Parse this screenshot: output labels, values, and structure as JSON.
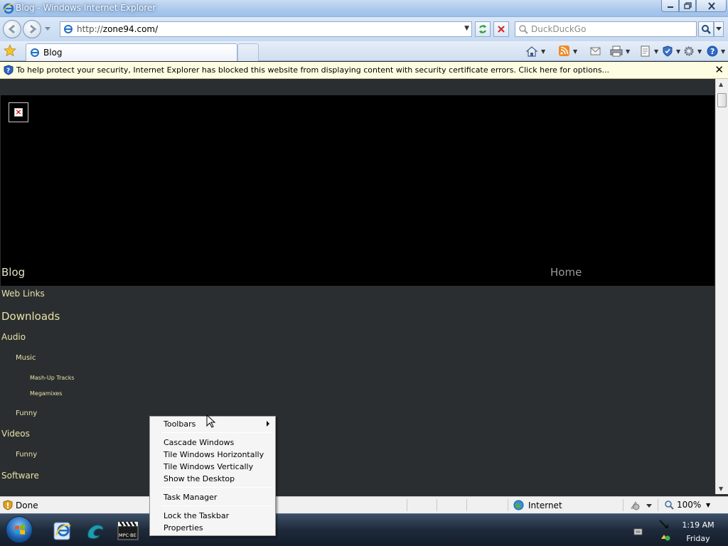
{
  "window": {
    "title": "Blog - Windows Internet Explorer"
  },
  "navigation": {
    "url_prefix": "http://",
    "url_host": "zone94.com/",
    "search_placeholder": "DuckDuckGo"
  },
  "tabs": [
    {
      "label": "Blog",
      "active": true
    }
  ],
  "infobar": {
    "message": "To help protect your security, Internet Explorer has blocked this website from displaying content with security certificate errors. Click here for options...",
    "close_glyph": "✕"
  },
  "page": {
    "site_title": "Blog",
    "home_link": "Home",
    "nav": {
      "web_links": "Web Links",
      "downloads": "Downloads",
      "audio": "Audio",
      "music": "Music",
      "mashup_tracks": "Mash-Up Tracks",
      "megamixes": "Megamixes",
      "funny_audio": "Funny",
      "videos": "Videos",
      "funny_videos": "Funny",
      "software": "Software"
    }
  },
  "statusbar": {
    "status": "Done",
    "zone": "Internet",
    "zoom": "100%"
  },
  "context_menu": {
    "items": [
      {
        "label": "Toolbars",
        "has_submenu": true
      },
      {
        "label": "Cascade Windows"
      },
      {
        "label": "Tile Windows Horizontally"
      },
      {
        "label": "Tile Windows Vertically"
      },
      {
        "label": "Show the Desktop"
      },
      {
        "label": "Task Manager"
      },
      {
        "label": "Lock the Taskbar"
      },
      {
        "label": "Properties"
      }
    ]
  },
  "taskbar": {
    "pinned": [
      "internet-explorer",
      "kali-dragon",
      "mpc-be"
    ],
    "mpc_label": "MPC·BE",
    "clock_time": "1:19 AM",
    "clock_day": "Friday"
  },
  "colors": {
    "page_background": "#2b2e30",
    "link_color": "#e8e2a8",
    "infobar_background": "#fffde1"
  }
}
